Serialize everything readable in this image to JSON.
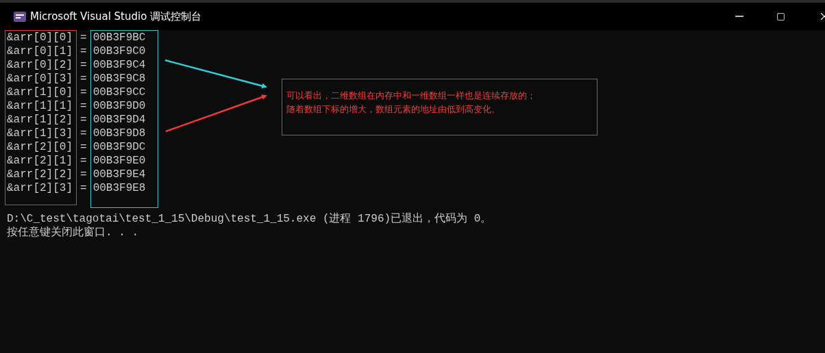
{
  "window": {
    "title": "Microsoft Visual Studio 调试控制台"
  },
  "console": {
    "rows": [
      {
        "expression": "&arr[0][0]",
        "operator": "=",
        "value": "00B3F9BC"
      },
      {
        "expression": "&arr[0][1]",
        "operator": "=",
        "value": "00B3F9C0"
      },
      {
        "expression": "&arr[0][2]",
        "operator": "=",
        "value": "00B3F9C4"
      },
      {
        "expression": "&arr[0][3]",
        "operator": "=",
        "value": "00B3F9C8"
      },
      {
        "expression": "&arr[1][0]",
        "operator": "=",
        "value": "00B3F9CC"
      },
      {
        "expression": "&arr[1][1]",
        "operator": "=",
        "value": "00B3F9D0"
      },
      {
        "expression": "&arr[1][2]",
        "operator": "=",
        "value": "00B3F9D4"
      },
      {
        "expression": "&arr[1][3]",
        "operator": "=",
        "value": "00B3F9D8"
      },
      {
        "expression": "&arr[2][0]",
        "operator": "=",
        "value": "00B3F9DC"
      },
      {
        "expression": "&arr[2][1]",
        "operator": "=",
        "value": "00B3F9E0"
      },
      {
        "expression": "&arr[2][2]",
        "operator": "=",
        "value": "00B3F9E4"
      },
      {
        "expression": "&arr[2][3]",
        "operator": "=",
        "value": "00B3F9E8"
      }
    ],
    "output": [
      "D:\\C_test\\tagotai\\test_1_15\\Debug\\test_1_15.exe (进程 1796)已退出，代码为 0。",
      "按任意键关闭此窗口. . ."
    ]
  },
  "annotation": {
    "lines": [
      "可以看出，二维数组在内存中和一维数组一样也是连续存放的；",
      "随着数组下标的增大，数组元素的地址由低到高变化。"
    ]
  }
}
